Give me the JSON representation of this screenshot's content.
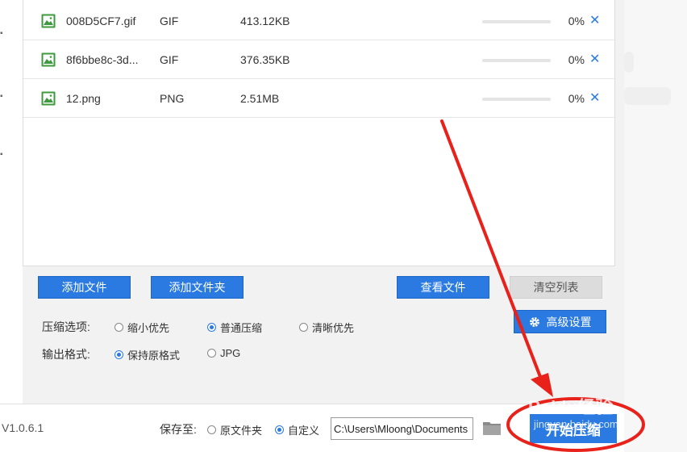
{
  "files": [
    {
      "name": "008D5CF7.gif",
      "type": "GIF",
      "size": "413.12KB",
      "progress": 0,
      "percent_text": "0%"
    },
    {
      "name": "8f6bbe8c-3d...",
      "type": "GIF",
      "size": "376.35KB",
      "progress": 0,
      "percent_text": "0%"
    },
    {
      "name": "12.png",
      "type": "PNG",
      "size": "2.51MB",
      "progress": 0,
      "percent_text": "0%"
    }
  ],
  "remove_symbol": "✕",
  "buttons": {
    "add_file": "添加文件",
    "add_folder": "添加文件夹",
    "view_files": "查看文件",
    "clear_list": "清空列表",
    "advanced": "高级设置",
    "start": "开始压缩"
  },
  "compress_options": {
    "label": "压缩选项:",
    "options": [
      "缩小优先",
      "普通压缩",
      "清晰优先"
    ],
    "selected": "普通压缩"
  },
  "output_format": {
    "label": "输出格式:",
    "options": [
      "保持原格式",
      "JPG"
    ],
    "selected": "保持原格式"
  },
  "bottom": {
    "version": "V1.0.6.1",
    "save_to_label": "保存至:",
    "save_options": [
      "原文件夹",
      "自定义"
    ],
    "save_selected": "自定义",
    "path_value": "C:\\Users\\Mloong\\Documents"
  },
  "watermark": {
    "text": "Baidu经验",
    "sub": "jingyan.baidu.com"
  },
  "colors": {
    "accent": "#2a7ae2",
    "annotation": "#e8211b"
  }
}
